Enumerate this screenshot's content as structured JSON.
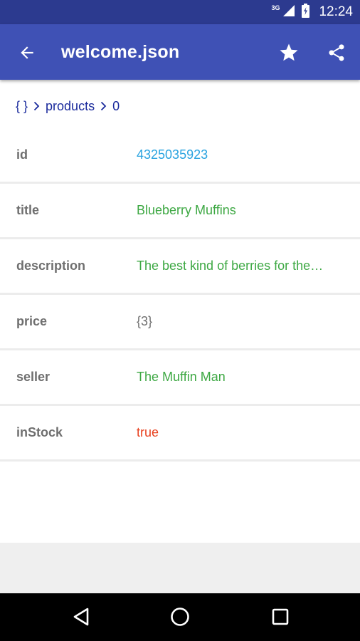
{
  "status_bar": {
    "network": "3G",
    "time": "12:24"
  },
  "app_bar": {
    "title": "welcome.json"
  },
  "breadcrumb": {
    "items": [
      "{ }",
      "products",
      "0"
    ]
  },
  "rows": [
    {
      "key": "id",
      "value": "4325035923",
      "color": "#29a3e0"
    },
    {
      "key": "title",
      "value": "Blueberry Muffins",
      "color": "#3da843"
    },
    {
      "key": "description",
      "value": "The best kind of berries for the…",
      "color": "#3da843"
    },
    {
      "key": "price",
      "value": "{3}",
      "color": "#6f6f6f"
    },
    {
      "key": "seller",
      "value": "The Muffin Man",
      "color": "#3da843"
    },
    {
      "key": "inStock",
      "value": "true",
      "color": "#e8411f"
    }
  ],
  "colors": {
    "primary": "#3f51b5",
    "status_bar": "#2c3a8f",
    "breadcrumb": "#1a2a9c"
  }
}
